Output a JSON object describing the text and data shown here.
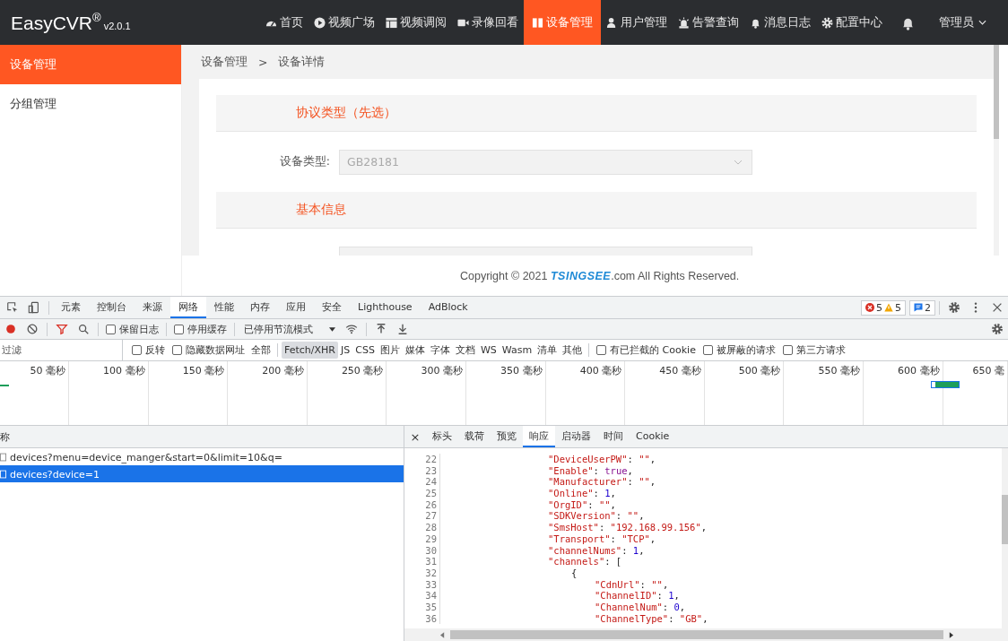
{
  "nav": {
    "logo": "EasyCVR",
    "logo_mark": "®",
    "version": "v2.0.1",
    "items": [
      {
        "label": "首页",
        "selected": false
      },
      {
        "label": "视频广场",
        "selected": false
      },
      {
        "label": "视频调阅",
        "selected": false
      },
      {
        "label": "录像回看",
        "selected": false
      },
      {
        "label": "设备管理",
        "selected": true
      },
      {
        "label": "用户管理",
        "selected": false
      },
      {
        "label": "告警查询",
        "selected": false
      },
      {
        "label": "消息日志",
        "selected": false
      },
      {
        "label": "配置中心",
        "selected": false
      }
    ],
    "user": "管理员"
  },
  "sidebar": {
    "items": [
      {
        "label": "设备管理",
        "selected": true
      },
      {
        "label": "分组管理",
        "selected": false
      }
    ]
  },
  "breadcrumb": {
    "items": [
      "设备管理",
      "设备详情"
    ],
    "separator": ">"
  },
  "sections": [
    {
      "title": "协议类型（先选）",
      "field": {
        "label": "设备类型:",
        "value": "GB28181",
        "disabled": true
      }
    },
    {
      "title": "基本信息"
    }
  ],
  "footer": {
    "before": "Copyright © 2021 ",
    "brand": "TSINGSEE",
    "after": ".com All Rights Reserved."
  },
  "devtools": {
    "panel_tabs": [
      {
        "label": "元素",
        "selected": false
      },
      {
        "label": "控制台",
        "selected": false
      },
      {
        "label": "来源",
        "selected": false
      },
      {
        "label": "网络",
        "selected": true
      },
      {
        "label": "性能",
        "selected": false
      },
      {
        "label": "内存",
        "selected": false
      },
      {
        "label": "应用",
        "selected": false
      },
      {
        "label": "安全",
        "selected": false
      },
      {
        "label": "Lighthouse",
        "selected": false
      },
      {
        "label": "AdBlock",
        "selected": false
      }
    ],
    "errors": "5",
    "warnings": "5",
    "messages": "2",
    "recording": true,
    "toolbar_checks": [
      {
        "label": "保留日志",
        "checked": false
      },
      {
        "label": "停用缓存",
        "checked": false
      }
    ],
    "throttling": "已停用节流模式",
    "filter": {
      "placeholder": "过滤",
      "options": [
        {
          "label": "反转",
          "checked": false
        },
        {
          "label": "隐藏数据网址",
          "checked": false
        }
      ],
      "types": [
        {
          "label": "全部",
          "selected": false
        },
        {
          "label": "Fetch/XHR",
          "selected": true
        },
        {
          "label": "JS",
          "selected": false
        },
        {
          "label": "CSS",
          "selected": false
        },
        {
          "label": "图片",
          "selected": false
        },
        {
          "label": "媒体",
          "selected": false
        },
        {
          "label": "字体",
          "selected": false
        },
        {
          "label": "文档",
          "selected": false
        },
        {
          "label": "WS",
          "selected": false
        },
        {
          "label": "Wasm",
          "selected": false
        },
        {
          "label": "清单",
          "selected": false
        },
        {
          "label": "其他",
          "selected": false
        }
      ],
      "extra": [
        {
          "label": "有已拦截的 Cookie",
          "checked": false
        },
        {
          "label": "被屏蔽的请求",
          "checked": false
        },
        {
          "label": "第三方请求",
          "checked": false
        }
      ]
    },
    "timeline": {
      "ticks": [
        "50 毫秒",
        "100 毫秒",
        "150 毫秒",
        "200 毫秒",
        "250 毫秒",
        "300 毫秒",
        "350 毫秒",
        "400 毫秒",
        "450 毫秒",
        "500 毫秒",
        "550 毫秒",
        "600 毫秒",
        "650 毫"
      ]
    },
    "requests": {
      "header": "称",
      "rows": [
        {
          "name": "devices?menu=device_manger&start=0&limit=10&q=",
          "selected": false
        },
        {
          "name": "devices?device=1",
          "selected": true
        }
      ]
    },
    "detail": {
      "close": "×",
      "tabs": [
        {
          "label": "标头",
          "selected": false
        },
        {
          "label": "载荷",
          "selected": false
        },
        {
          "label": "预览",
          "selected": false
        },
        {
          "label": "响应",
          "selected": true
        },
        {
          "label": "启动器",
          "selected": false
        },
        {
          "label": "时间",
          "selected": false
        },
        {
          "label": "Cookie",
          "selected": false
        }
      ],
      "lines": [
        {
          "num": "22",
          "tokens": [
            {
              "kind": "key",
              "text": "\"DeviceUserPW\""
            },
            {
              "kind": "punct",
              "text": ": "
            },
            {
              "kind": "string",
              "text": "\"\""
            },
            {
              "kind": "punct",
              "text": ","
            }
          ]
        },
        {
          "num": "23",
          "tokens": [
            {
              "kind": "key",
              "text": "\"Enable\""
            },
            {
              "kind": "punct",
              "text": ": "
            },
            {
              "kind": "literal",
              "text": "true"
            },
            {
              "kind": "punct",
              "text": ","
            }
          ]
        },
        {
          "num": "24",
          "tokens": [
            {
              "kind": "key",
              "text": "\"Manufacturer\""
            },
            {
              "kind": "punct",
              "text": ": "
            },
            {
              "kind": "string",
              "text": "\"\""
            },
            {
              "kind": "punct",
              "text": ","
            }
          ]
        },
        {
          "num": "25",
          "tokens": [
            {
              "kind": "key",
              "text": "\"Online\""
            },
            {
              "kind": "punct",
              "text": ": "
            },
            {
              "kind": "number",
              "text": "1"
            },
            {
              "kind": "punct",
              "text": ","
            }
          ]
        },
        {
          "num": "26",
          "tokens": [
            {
              "kind": "key",
              "text": "\"OrgID\""
            },
            {
              "kind": "punct",
              "text": ": "
            },
            {
              "kind": "string",
              "text": "\"\""
            },
            {
              "kind": "punct",
              "text": ","
            }
          ]
        },
        {
          "num": "27",
          "tokens": [
            {
              "kind": "key",
              "text": "\"SDKVersion\""
            },
            {
              "kind": "punct",
              "text": ": "
            },
            {
              "kind": "string",
              "text": "\"\""
            },
            {
              "kind": "punct",
              "text": ","
            }
          ]
        },
        {
          "num": "28",
          "tokens": [
            {
              "kind": "key",
              "text": "\"SmsHost\""
            },
            {
              "kind": "punct",
              "text": ": "
            },
            {
              "kind": "string",
              "text": "\"192.168.99.156\""
            },
            {
              "kind": "punct",
              "text": ","
            }
          ]
        },
        {
          "num": "29",
          "tokens": [
            {
              "kind": "key",
              "text": "\"Transport\""
            },
            {
              "kind": "punct",
              "text": ": "
            },
            {
              "kind": "string",
              "text": "\"TCP\""
            },
            {
              "kind": "punct",
              "text": ","
            }
          ]
        },
        {
          "num": "30",
          "tokens": [
            {
              "kind": "key",
              "text": "\"channelNums\""
            },
            {
              "kind": "punct",
              "text": ": "
            },
            {
              "kind": "number",
              "text": "1"
            },
            {
              "kind": "punct",
              "text": ","
            }
          ]
        },
        {
          "num": "31",
          "tokens": [
            {
              "kind": "key",
              "text": "\"channels\""
            },
            {
              "kind": "punct",
              "text": ": ["
            }
          ],
          "children": [
            {
              "num": "32",
              "tokens": [
                {
                  "kind": "punct",
                  "text": "{"
                }
              ],
              "children": [
                {
                  "num": "33",
                  "tokens": [
                    {
                      "kind": "key",
                      "text": "\"CdnUrl\""
                    },
                    {
                      "kind": "punct",
                      "text": ": "
                    },
                    {
                      "kind": "string",
                      "text": "\"\""
                    },
                    {
                      "kind": "punct",
                      "text": ","
                    }
                  ]
                },
                {
                  "num": "34",
                  "tokens": [
                    {
                      "kind": "key",
                      "text": "\"ChannelID\""
                    },
                    {
                      "kind": "punct",
                      "text": ": "
                    },
                    {
                      "kind": "number",
                      "text": "1"
                    },
                    {
                      "kind": "punct",
                      "text": ","
                    }
                  ]
                },
                {
                  "num": "35",
                  "tokens": [
                    {
                      "kind": "key",
                      "text": "\"ChannelNum\""
                    },
                    {
                      "kind": "punct",
                      "text": ": "
                    },
                    {
                      "kind": "number",
                      "text": "0"
                    },
                    {
                      "kind": "punct",
                      "text": ","
                    }
                  ]
                },
                {
                  "num": "36",
                  "tokens": [
                    {
                      "kind": "key",
                      "text": "\"ChannelType\""
                    },
                    {
                      "kind": "punct",
                      "text": ": "
                    },
                    {
                      "kind": "string",
                      "text": "\"GB\""
                    },
                    {
                      "kind": "punct",
                      "text": ","
                    }
                  ]
                }
              ]
            }
          ]
        }
      ]
    }
  }
}
